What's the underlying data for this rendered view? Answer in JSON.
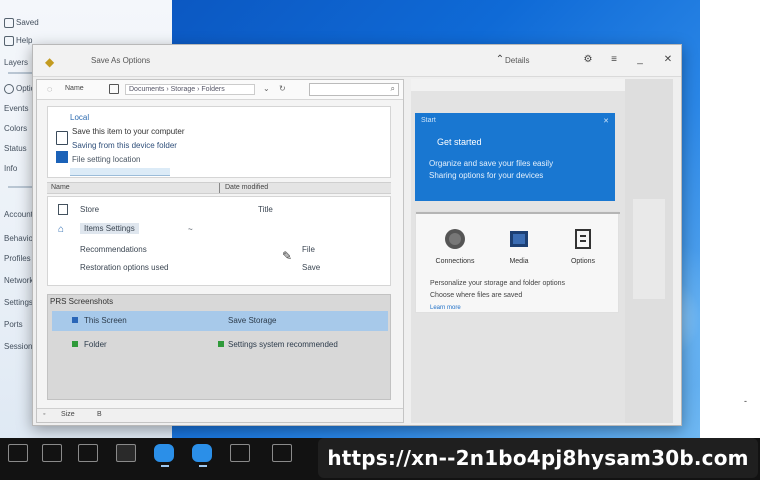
{
  "left_panel": {
    "items": [
      "Saved",
      "Help",
      "Layers",
      "Options",
      "Events",
      "Colors",
      "Status",
      "Info",
      "Accounts",
      "Behaviors",
      "Profiles",
      "Network",
      "Settings",
      "Ports",
      "Sessions"
    ]
  },
  "window": {
    "title": "Save As Options",
    "controls": [
      "_",
      "▢",
      "✕",
      "⌃",
      "⚙",
      "≡"
    ],
    "right_title": "Details"
  },
  "toolbar": {
    "title": "Name",
    "path": "Documents › Storage › Folders",
    "search": ""
  },
  "detail": {
    "heading": "Local",
    "line1": "Save this item to your computer",
    "line2": "Saving from this device folder",
    "line3": "File setting location"
  },
  "columns": [
    "Name",
    "Date modified"
  ],
  "list": {
    "rows": [
      {
        "name": "Store",
        "right": "Title"
      },
      {
        "name": "Items Settings",
        "right": "~"
      },
      {
        "name": "Recommendations",
        "right": "File"
      },
      {
        "name": "Restoration options used",
        "right": "Save"
      }
    ]
  },
  "group": {
    "title": "PRS  Screenshots",
    "rows": [
      {
        "left": "This Screen",
        "right": "Save   Storage"
      },
      {
        "left": "Folder",
        "right": "Settings system recommended"
      }
    ]
  },
  "status": {
    "left": "Size",
    "right": "B"
  },
  "card": {
    "top": "Start",
    "title": "Get started",
    "sub1": "Organize and save your files easily",
    "sub2": "Sharing options for your devices"
  },
  "tiles": [
    {
      "label": "Connections"
    },
    {
      "label": "Media"
    },
    {
      "label": "Options"
    }
  ],
  "tile_desc": [
    "Personalize your storage and folder options",
    "Choose where files are saved"
  ],
  "tile_link": "Learn more",
  "overlay": {
    "url": "https://xn--2n1bo4pj8hysam30b.com"
  },
  "colors": {
    "accent": "#1977d1",
    "selection": "#a7c9ea",
    "taskbar": "#121212",
    "desktop": "#0f6ad6"
  }
}
